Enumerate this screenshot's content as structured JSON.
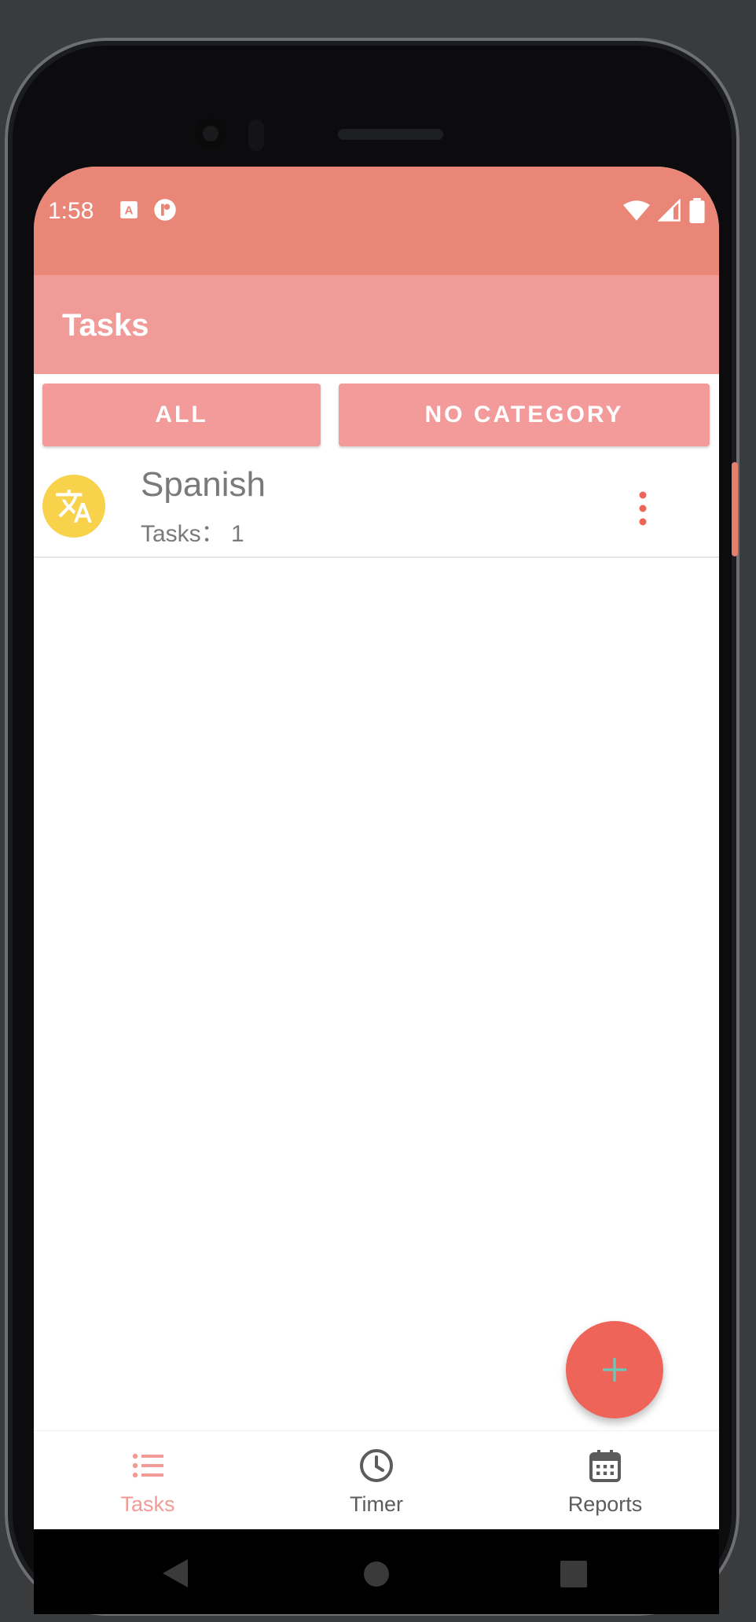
{
  "status_bar": {
    "time": "1:58",
    "icons": [
      "keyboard-a-icon",
      "circle-app-icon",
      "wifi-icon",
      "signal-icon",
      "battery-icon"
    ]
  },
  "app_bar": {
    "title": "Tasks"
  },
  "filters": [
    {
      "label": "ALL"
    },
    {
      "label": "NO CATEGORY"
    }
  ],
  "categories": [
    {
      "name": "Spanish",
      "subtitle": "Tasks： 1",
      "icon": "translate-icon",
      "color": "#f7d24a"
    }
  ],
  "fab": {
    "icon": "plus-icon"
  },
  "bottom_nav": {
    "items": [
      {
        "label": "Tasks",
        "icon": "list-icon",
        "active": true
      },
      {
        "label": "Timer",
        "icon": "clock-icon",
        "active": false
      },
      {
        "label": "Reports",
        "icon": "calendar-icon",
        "active": false
      }
    ]
  },
  "colors": {
    "status_bar": "#e98677",
    "app_bar": "#f09b98",
    "accent": "#f29a96",
    "fab": "#ee6459",
    "fab_icon": "#6cc7b8",
    "category_avatar": "#f7d24a"
  }
}
